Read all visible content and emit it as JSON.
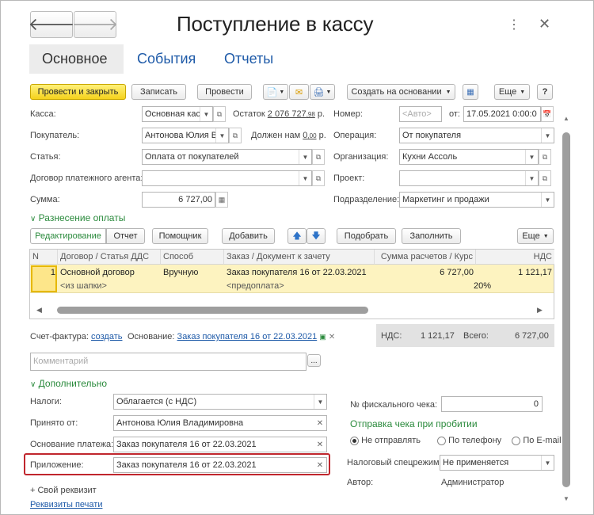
{
  "window": {
    "title": "Поступление в кассу",
    "back_icon": "arrow-left-icon",
    "forward_icon": "arrow-right-icon"
  },
  "tabs": [
    {
      "label": "Основное"
    },
    {
      "label": "События"
    },
    {
      "label": "Отчеты"
    }
  ],
  "toolbar": {
    "post_close": "Провести и закрыть",
    "save": "Записать",
    "post": "Провести",
    "create_based": "Создать на основании",
    "more": "Еще",
    "help": "?"
  },
  "header": {
    "kassa_label": "Касса:",
    "kassa_value": "Основная кас",
    "ostatok_label": "Остаток",
    "ostatok_int": "2 076 727",
    "ostatok_dec": ",98",
    "ostatok_unit": "р.",
    "nomer_label": "Номер:",
    "nomer_placeholder": "<Авто>",
    "ot_label": "от:",
    "date_value": "17.05.2021  0:00:0",
    "buyer_label": "Покупатель:",
    "buyer_value": "Антонова Юлия В",
    "dolzhen_label": "Должен нам",
    "dolzhen_int": "0",
    "dolzhen_dec": ",00",
    "dolzhen_unit": "р.",
    "operation_label": "Операция:",
    "operation_value": "От покупателя",
    "statya_label": "Статья:",
    "statya_value": "Оплата от покупателей",
    "org_label": "Организация:",
    "org_value": "Кухни Ассоль",
    "dogovor_label": "Договор платежного агента:",
    "dogovor_value": "",
    "project_label": "Проект:",
    "project_value": "",
    "summa_label": "Сумма:",
    "summa_value": "6 727,00",
    "podr_label": "Подразделение:",
    "podr_value": "Маркетинг и продажи"
  },
  "payment_section": {
    "title": "Разнесение оплаты",
    "edit_tab": "Редактирование",
    "report_tab": "Отчет",
    "assistant": "Помощник",
    "add": "Добавить",
    "pick": "Подобрать",
    "fill": "Заполнить",
    "more": "Еще"
  },
  "table": {
    "columns": [
      "N",
      "Договор / Статья ДДС",
      "Способ",
      "Заказ / Документ к зачету",
      "Сумма расчетов / Курс",
      "НДС"
    ],
    "row": {
      "n": "1",
      "dogovor": "Основной договор",
      "sposob": "Вручную",
      "zakaz": "Заказ покупателя 16 от 22.03.2021",
      "summa": "6 727,00",
      "nds": "1 121,17",
      "dogovor2": "<из шапки>",
      "zakaz2": "<предоплата>",
      "rate": "20%"
    }
  },
  "invoice": {
    "label": "Счет-фактура:",
    "create_link": "создать",
    "basis_label": "Основание:",
    "basis_link": "Заказ покупателя 16 от 22.03.2021"
  },
  "totals": {
    "nds_label": "НДС:",
    "nds_value": "1 121,17",
    "total_label": "Всего:",
    "total_value": "6 727,00"
  },
  "comment": {
    "placeholder": "Комментарий"
  },
  "additional": {
    "title": "Дополнительно",
    "taxes_label": "Налоги:",
    "taxes_value": "Облагается (с НДС)",
    "received_label": "Принято от:",
    "received_value": "Антонова Юлия Владимировна",
    "basis_label": "Основание платежа:",
    "basis_value": "Заказ покупателя 16 от 22.03.2021",
    "attach_label": "Приложение:",
    "attach_value": "Заказ покупателя 16 от 22.03.2021",
    "fiscal_label": "№ фискального чека:",
    "fiscal_value": "0",
    "receipt_title": "Отправка чека при пробитии",
    "radio_none": "Не отправлять",
    "radio_phone": "По телефону",
    "radio_email": "По E-mail",
    "tax_regime_label": "Налоговый спецрежим:",
    "tax_regime_value": "Не применяется",
    "author_label": "Автор:",
    "author_value": "Администратор",
    "own_prop": "+ Свой реквизит",
    "print_props": "Реквизиты печати"
  },
  "colors": {
    "primary_button": "#f5d21c",
    "link": "#1e5aa8",
    "section": "#2a8a3c",
    "selected_row": "#fdf3c0",
    "highlight_border": "#c0262d"
  }
}
